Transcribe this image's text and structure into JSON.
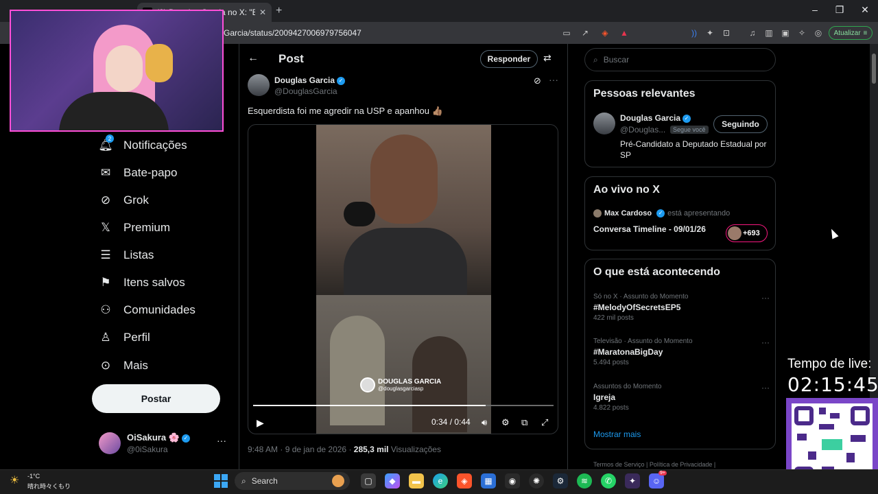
{
  "browser": {
    "tab_title": "(2) Douglas Garcia no X: \"Esquerdista foi me agredir na USP e apanhou",
    "tab_logo": "X",
    "url": "Garcia/status/2009427006979756047",
    "update_label": "Atualizar",
    "icons": [
      "screen-cast-icon",
      "share-icon",
      "brave-shield-icon",
      "brave-rewards-icon",
      "audio-icon",
      "extensions-icon",
      "tab-search-icon",
      "media-icon",
      "sidebar-icon",
      "wallet-icon",
      "leo-icon",
      "vpn-icon",
      "menu-icon"
    ]
  },
  "nav": {
    "items": [
      {
        "label": "Notificações",
        "icon": "bell-icon",
        "badge": "2"
      },
      {
        "label": "Bate-papo",
        "icon": "envelope-icon"
      },
      {
        "label": "Grok",
        "icon": "grok-icon"
      },
      {
        "label": "Premium",
        "icon": "x-logo-icon"
      },
      {
        "label": "Listas",
        "icon": "list-icon"
      },
      {
        "label": "Itens salvos",
        "icon": "bookmark-icon"
      },
      {
        "label": "Comunidades",
        "icon": "communities-icon"
      },
      {
        "label": "Perfil",
        "icon": "person-icon"
      },
      {
        "label": "Mais",
        "icon": "more-circle-icon"
      }
    ],
    "post_button": "Postar",
    "profile": {
      "name": "OiSakura 🌸",
      "handle": "@0iSakura",
      "more": "···"
    }
  },
  "main": {
    "heading": "Post",
    "reply_button": "Responder",
    "author": {
      "name": "Douglas Garcia",
      "handle": "@DouglasGarcia"
    },
    "text": "Esquerdista foi me agredir na USP e apanhou 👍🏽",
    "more": "···",
    "video": {
      "watermark_name": "DOUGLAS GARCIA",
      "watermark_handle": "@douglasgarciasp",
      "timecode": "0:34 / 0:44",
      "progress": 0.773
    },
    "meta_time": "9:48 AM · 9 de jan de 2026 · ",
    "meta_views_count": "285,3 mil",
    "meta_views_label": " Visualizações"
  },
  "sidebar": {
    "search_placeholder": "Buscar",
    "relevant": {
      "title": "Pessoas relevantes",
      "name": "Douglas Garcia",
      "handle": "@Douglas...",
      "follows_you": "Segue você",
      "following_button": "Seguindo",
      "bio": "Pré-Candidato a Deputado Estadual por SP"
    },
    "live": {
      "title": "Ao vivo no X",
      "host": "Max Cardoso",
      "host_suffix": "está apresentando",
      "show_title": "Conversa Timeline - 09/01/26",
      "listeners": "+693"
    },
    "trends": {
      "title": "O que está acontecendo",
      "items": [
        {
          "meta": "Só no X · Assunto do Momento",
          "name": "#MelodyOfSecretsEP5",
          "count": "422 mil posts"
        },
        {
          "meta": "Televisão · Assunto do Momento",
          "name": "#MaratonaBigDay",
          "count": "5.494 posts"
        },
        {
          "meta": "Assuntos do Momento",
          "name": "Igreja",
          "count": "4.822 posts"
        }
      ],
      "more": "···",
      "show_more": "Mostrar mais"
    },
    "footer": "Termos de Serviço  |  Política de Privacidade  |"
  },
  "overlay": {
    "live_label": "Tempo de live:",
    "live_timer": "02:15:45"
  },
  "taskbar": {
    "temp": "-1°C",
    "weather_desc": "晴れ時々くもり",
    "search_label": "Search",
    "apps": [
      "task-view-icon",
      "copilot-icon",
      "file-explorer-icon",
      "edge-icon",
      "brave-icon",
      "store-icon",
      "capture-icon",
      "chatgpt-icon",
      "steam-icon",
      "spotify-icon",
      "whatsapp-icon",
      "app-icon",
      "discord-icon"
    ],
    "discord_badge": "9+"
  },
  "colors": {
    "accent": "#1d9bf0",
    "live_pink": "#f91880",
    "qr_purple": "#7a46c8",
    "webcam_border": "#ff4fd8"
  }
}
